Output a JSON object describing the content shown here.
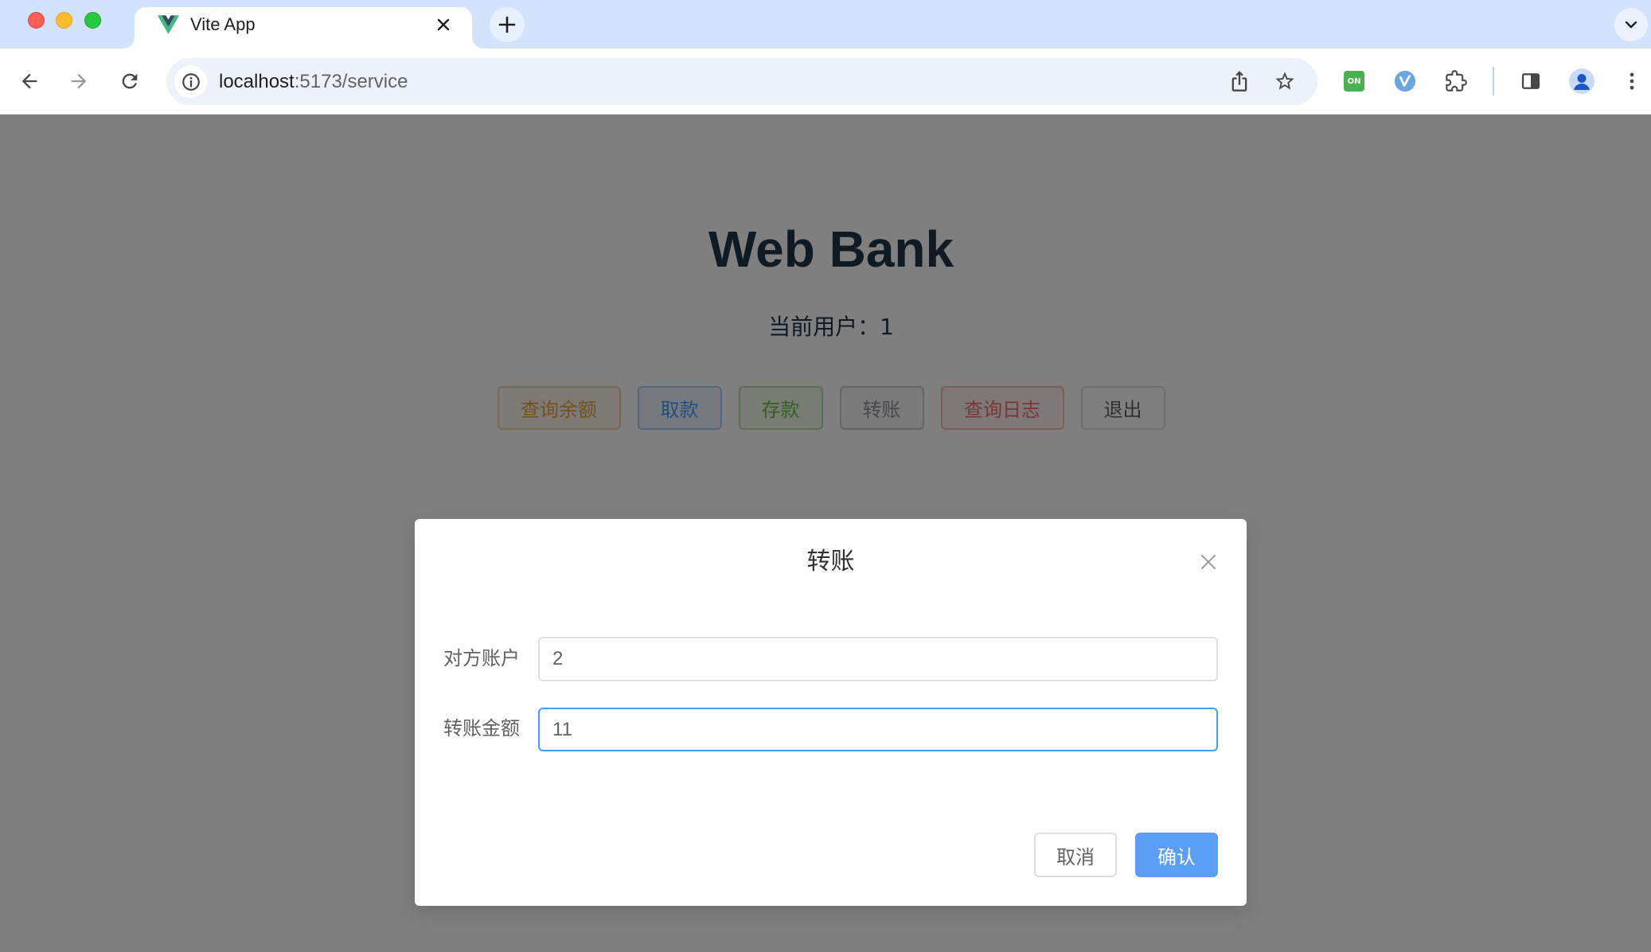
{
  "browser": {
    "tab": {
      "title": "Vite App",
      "favicon": "vue-logo-icon"
    },
    "omnibox": {
      "host": "localhost",
      "path": ":5173/service"
    },
    "extension_badge": "ON",
    "toolbar_icons": [
      "back-arrow-icon",
      "forward-arrow-icon",
      "reload-icon",
      "site-info-icon",
      "share-icon",
      "bookmark-star-icon",
      "extension-on-icon",
      "extension-v-icon",
      "extensions-puzzle-icon",
      "side-panel-icon",
      "profile-avatar-icon",
      "menu-kebab-icon"
    ]
  },
  "page": {
    "title": "Web Bank",
    "current_user_label": "当前用户：",
    "current_user_value": "1",
    "actions": [
      "查询余额",
      "取款",
      "存款",
      "转账",
      "查询日志",
      "退出"
    ]
  },
  "dialog": {
    "title": "转账",
    "fields": [
      {
        "label": "对方账户",
        "value": "2",
        "focused": false
      },
      {
        "label": "转账金额",
        "value": "11",
        "focused": true
      }
    ],
    "cancel_label": "取消",
    "confirm_label": "确认"
  },
  "colors": {
    "tab_strip": "#d3e3fd",
    "primary": "#409eff",
    "warning": "#e6a23c",
    "success": "#67c23a",
    "info": "#909399",
    "danger": "#f56c6c",
    "confirm_button": "#5a9ef6"
  }
}
